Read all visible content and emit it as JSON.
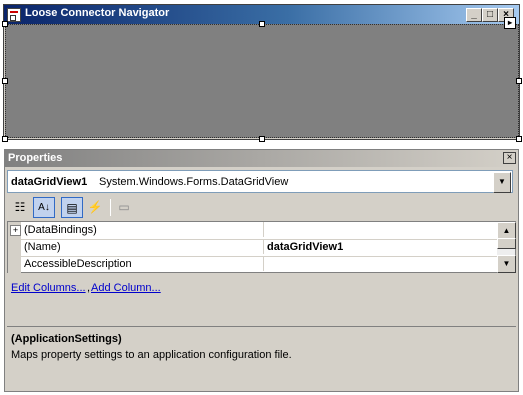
{
  "window": {
    "title": "Loose Connector Navigator",
    "buttons": {
      "minimize": "_",
      "maximize": "□",
      "close": "×"
    },
    "smart_tag": "▸"
  },
  "properties": {
    "title": "Properties",
    "close": "×",
    "object_name": "dataGridView1",
    "object_type": "System.Windows.Forms.DataGridView",
    "toolbar": {
      "categorized": "☷",
      "alphabetical": "A↓",
      "properties": "▤",
      "events": "⚡",
      "property_pages": "▭"
    },
    "rows": [
      {
        "expander": "+",
        "name": "(DataBindings)",
        "value": "",
        "bold": false
      },
      {
        "expander": "",
        "name": "(Name)",
        "value": "dataGridView1",
        "bold": true
      },
      {
        "expander": "",
        "name": "AccessibleDescription",
        "value": "",
        "bold": false
      }
    ],
    "links": {
      "edit_columns": "Edit Columns...",
      "separator": ",",
      "add_column": "Add Column..."
    },
    "description": {
      "heading": "(ApplicationSettings)",
      "text": "Maps property settings to an application configuration file."
    }
  }
}
